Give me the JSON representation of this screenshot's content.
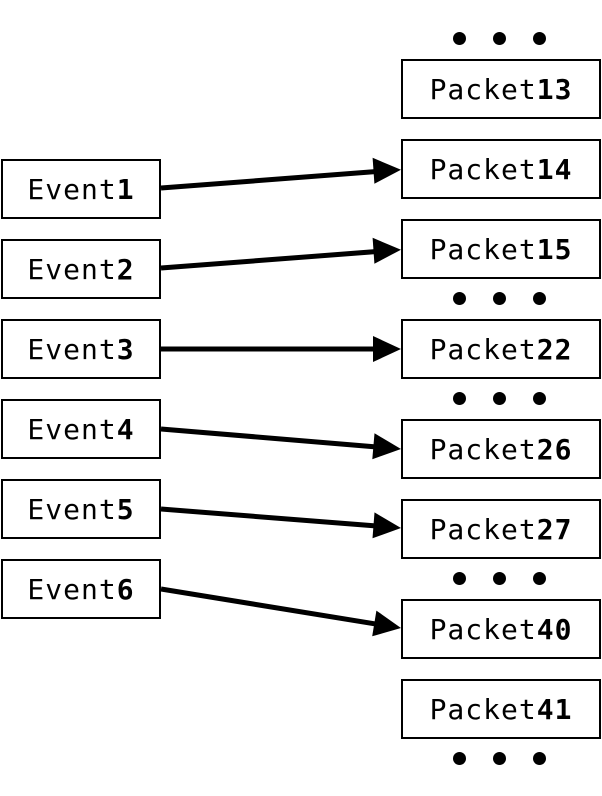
{
  "events": [
    {
      "word": "Event",
      "num": "1"
    },
    {
      "word": "Event",
      "num": "2"
    },
    {
      "word": "Event",
      "num": "3"
    },
    {
      "word": "Event",
      "num": "4"
    },
    {
      "word": "Event",
      "num": "5"
    },
    {
      "word": "Event",
      "num": "6"
    }
  ],
  "packets": [
    {
      "word": "Packet",
      "num": "13"
    },
    {
      "word": "Packet",
      "num": "14"
    },
    {
      "word": "Packet",
      "num": "15"
    },
    {
      "word": "Packet",
      "num": "22"
    },
    {
      "word": "Packet",
      "num": "26"
    },
    {
      "word": "Packet",
      "num": "27"
    },
    {
      "word": "Packet",
      "num": "40"
    },
    {
      "word": "Packet",
      "num": "41"
    }
  ],
  "mappings": [
    {
      "from": "Event 1",
      "to": "Packet 14"
    },
    {
      "from": "Event 2",
      "to": "Packet 15"
    },
    {
      "from": "Event 3",
      "to": "Packet 22"
    },
    {
      "from": "Event 4",
      "to": "Packet 26"
    },
    {
      "from": "Event 5",
      "to": "Packet 27"
    },
    {
      "from": "Event 6",
      "to": "Packet 40"
    }
  ],
  "colors": {
    "stroke": "#000000",
    "background": "#ffffff"
  }
}
